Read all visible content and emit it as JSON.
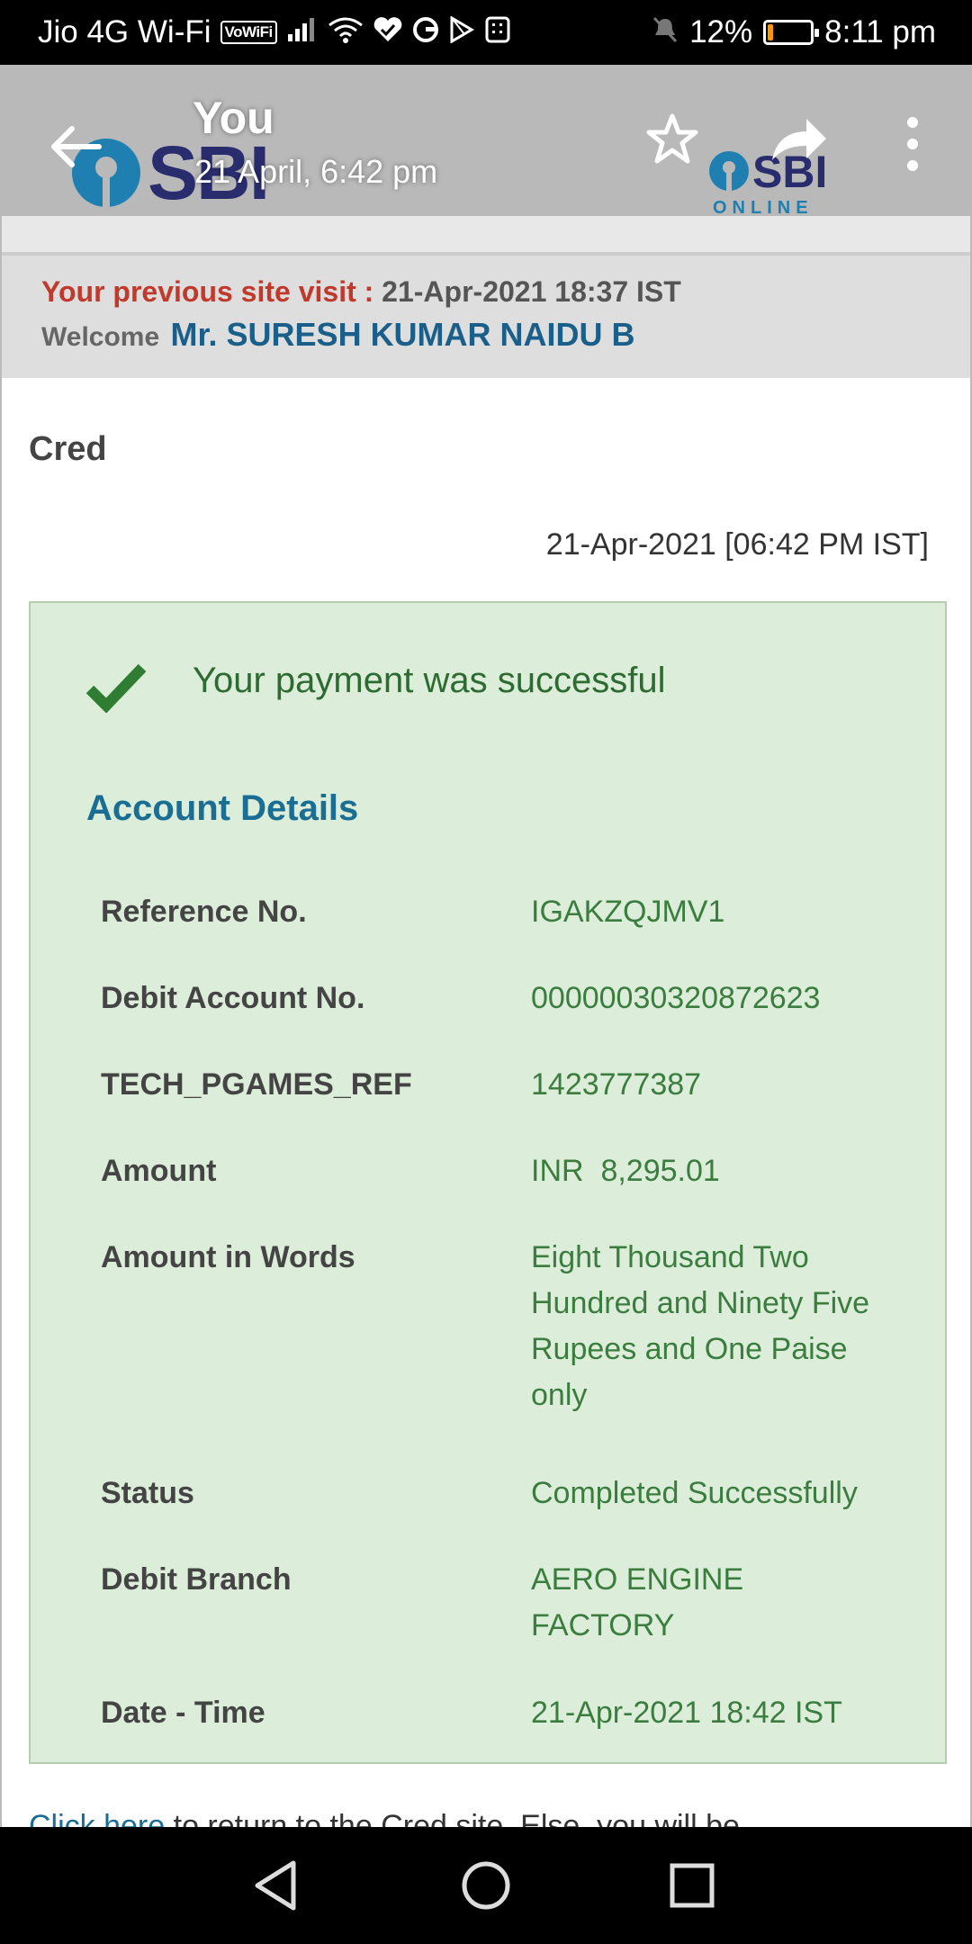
{
  "status_bar": {
    "carrier": "Jio 4G Wi-Fi",
    "vowifi": "VoWiFi",
    "battery_percent": "12%",
    "battery_level": 0.12,
    "time": "8:11 pm"
  },
  "viewer": {
    "sender": "You",
    "date": "21 April, 6:42 pm"
  },
  "bank": {
    "logo_text": "SBI",
    "online_text": "ONLINE"
  },
  "visit": {
    "label": "Your previous site visit :",
    "value": "21-Apr-2021 18:37 IST",
    "welcome_label": "Welcome",
    "user_name": "Mr. SURESH KUMAR NAIDU B"
  },
  "merchant": "Cred",
  "transaction_datetime": "21-Apr-2021 [06:42 PM IST]",
  "success_message": "Your payment was successful",
  "account_details_title": "Account Details",
  "details": [
    {
      "label": "Reference No.",
      "value": "IGAKZQJMV1"
    },
    {
      "label": "Debit Account No.",
      "value": "00000030320872623"
    },
    {
      "label": "TECH_PGAMES_REF",
      "value": "1423777387"
    },
    {
      "label": "Amount",
      "value": "INR  8,295.01"
    },
    {
      "label": "Amount in Words",
      "value": "Eight Thousand Two Hundred and Ninety Five Rupees and One Paise only"
    },
    {
      "label": "Status",
      "value": "Completed Successfully"
    },
    {
      "label": "Debit Branch",
      "value": "AERO ENGINE FACTORY"
    },
    {
      "label": "Date - Time",
      "value": "21-Apr-2021 18:42 IST"
    }
  ],
  "return": {
    "link_text": "Click here",
    "rest_text": " to return to the Cred site. Else, you will be"
  },
  "colors": {
    "success_bg": "#dcedd9",
    "success_text": "#3b7d3f",
    "heading_blue": "#1a6e93",
    "visit_label_red": "#c0392b",
    "sbi_blue": "#1f7fb0",
    "sbi_navy": "#292d6e"
  },
  "icons": {
    "back": "arrow-left-icon",
    "star": "star-outline-icon",
    "share": "share-arrow-icon",
    "more": "more-vertical-icon",
    "check": "check-mark-icon",
    "nav_back": "triangle-back-icon",
    "nav_home": "circle-home-icon",
    "nav_recents": "square-recents-icon"
  }
}
